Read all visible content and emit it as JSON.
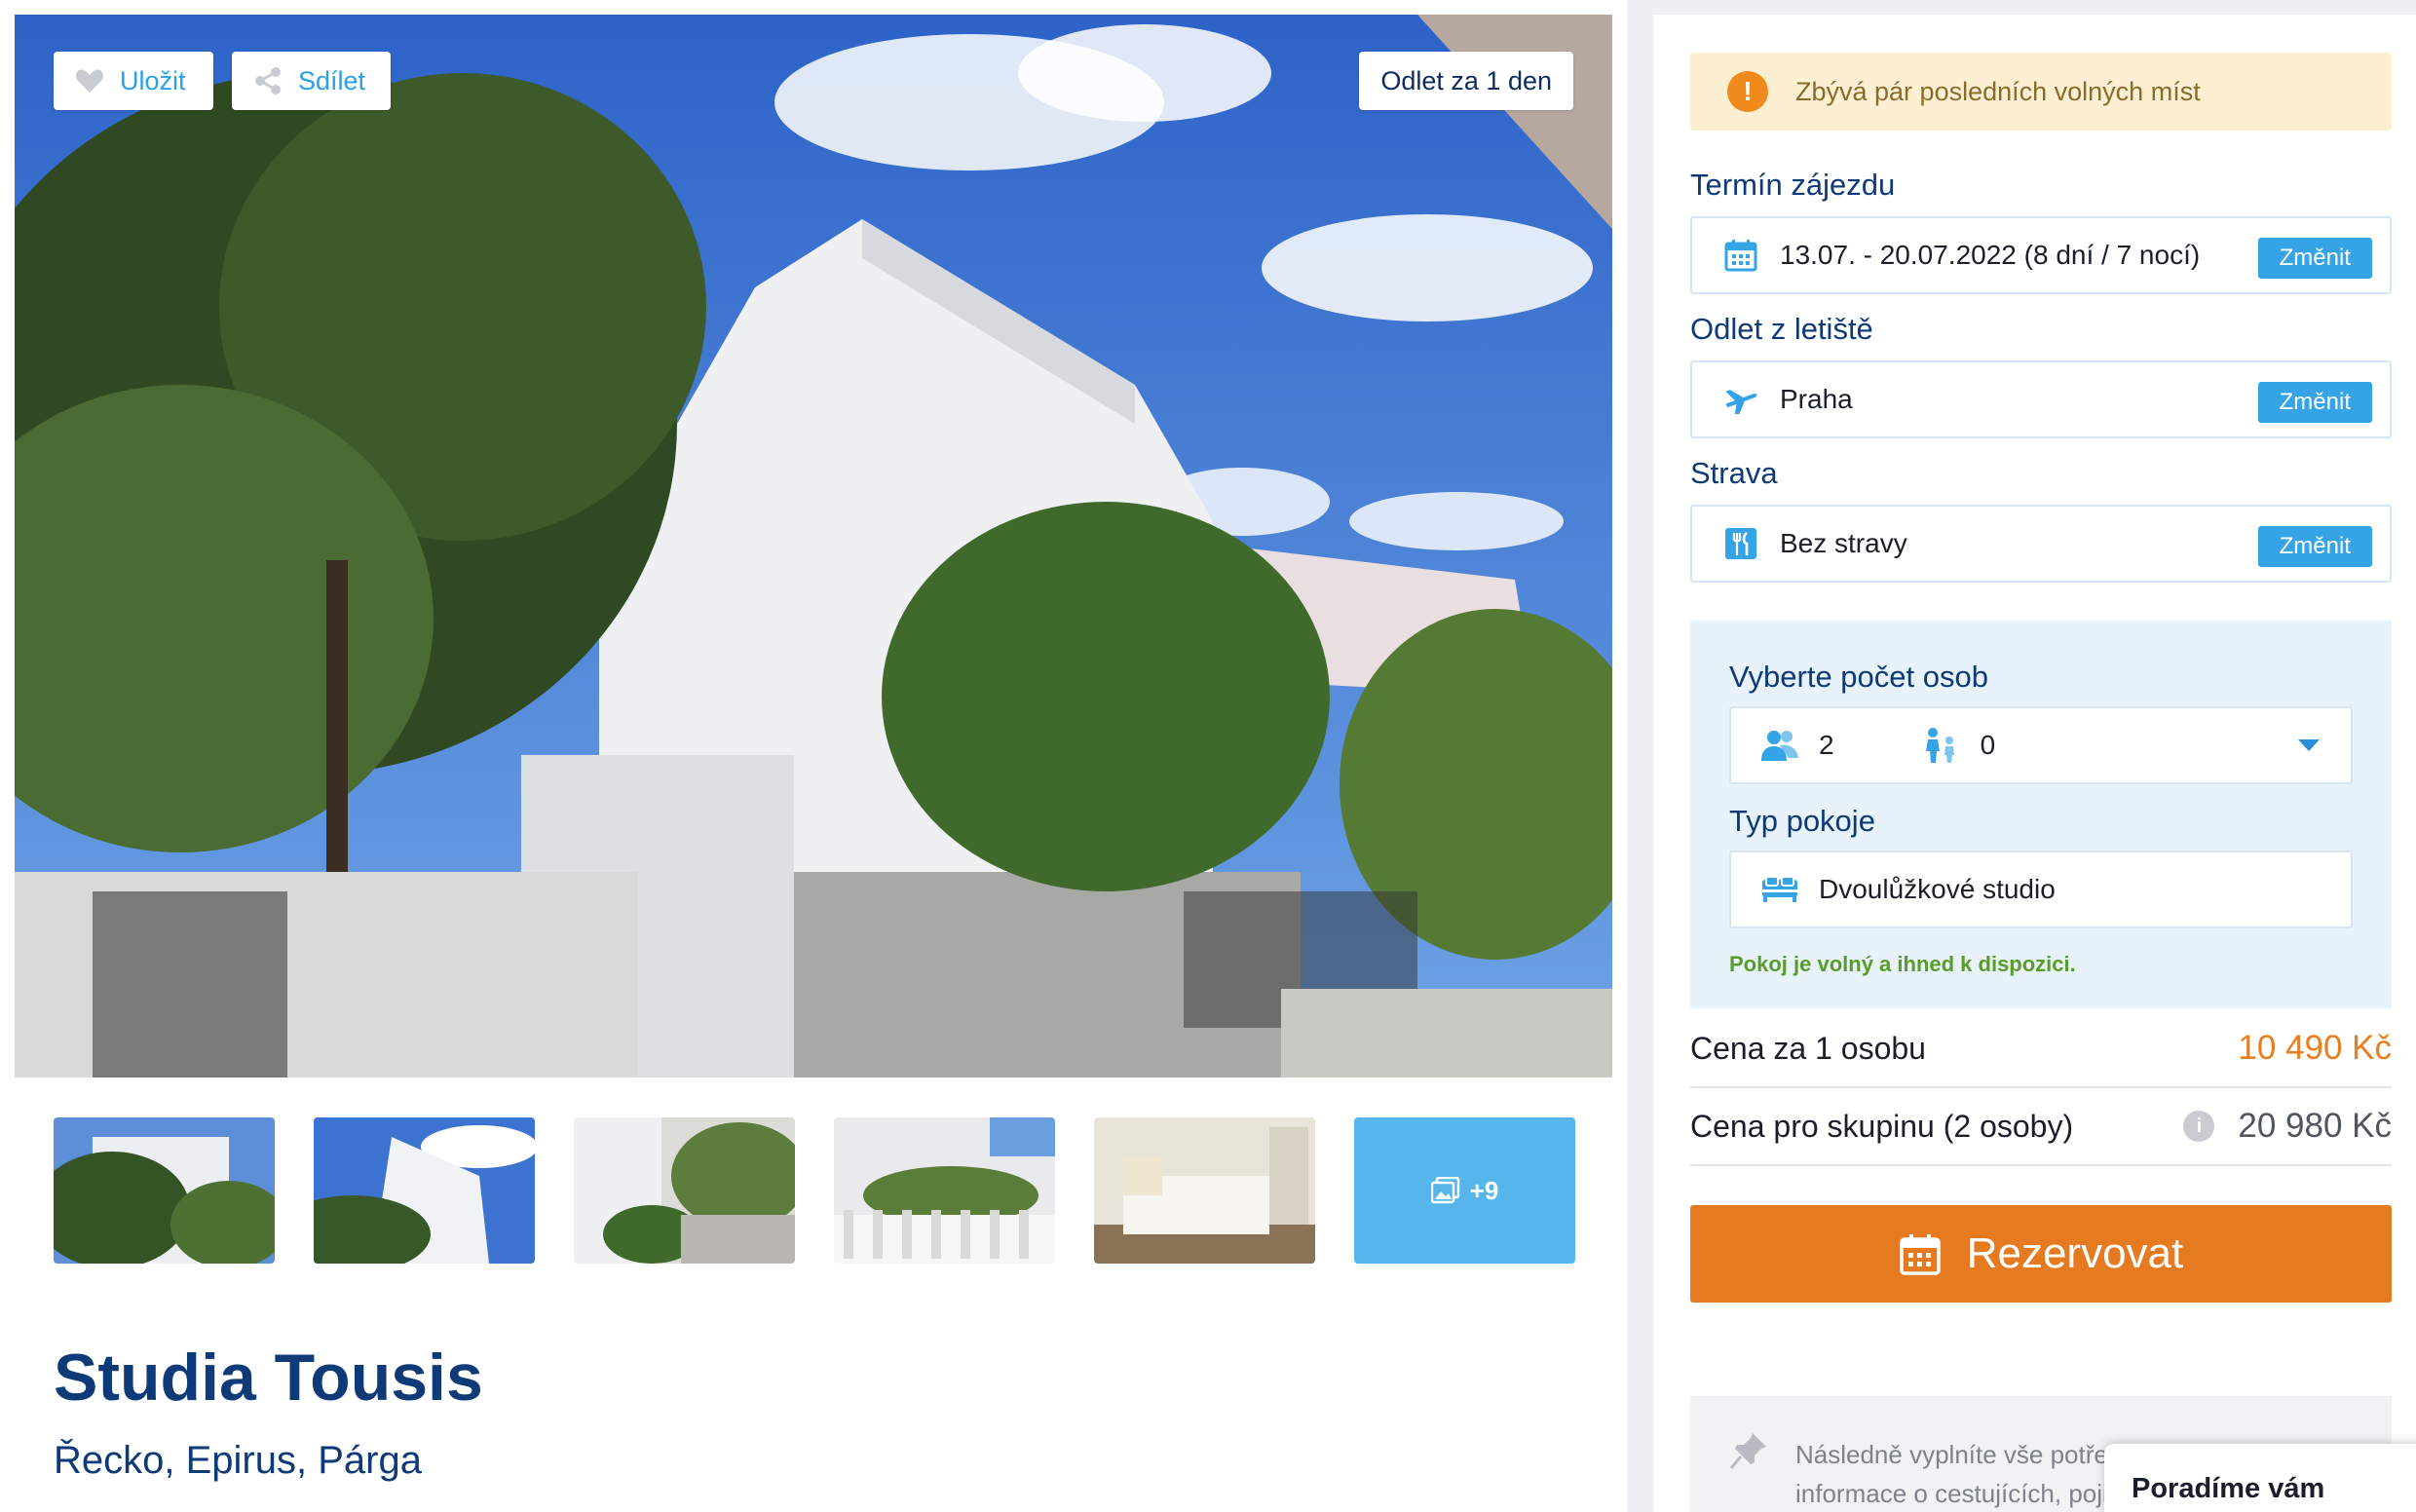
{
  "gallery": {
    "save_label": "Uložit",
    "share_label": "Sdílet",
    "departure_badge": "Odlet za 1 den",
    "more_photos": "+9"
  },
  "hotel": {
    "title": "Studia Tousis",
    "location": "Řecko, Epirus, Párga"
  },
  "booking": {
    "alert": "Zbývá pár posledních volných míst",
    "term_label": "Termín zájezdu",
    "term_value": "13.07. - 20.07.2022 (8 dní / 7 nocí)",
    "airport_label": "Odlet z letiště",
    "airport_value": "Praha",
    "board_label": "Strava",
    "board_value": "Bez stravy",
    "change_label": "Změnit",
    "persons_label": "Vyberte počet osob",
    "adults": "2",
    "children": "0",
    "room_label": "Typ pokoje",
    "room_value": "Dvoulůžkové studio",
    "room_status": "Pokoj je volný a ihned k dispozici.",
    "price_person_label": "Cena za 1 osobu",
    "price_person_value": "10 490 Kč",
    "price_group_label": "Cena pro skupinu (2 osoby)",
    "price_group_value": "20 980 Kč",
    "book_label": "Rezervovat",
    "note_text": "Následně vyplníte vše potřebné k rezervaci tedy informace o cestujících, pojištění a způsob platby"
  },
  "chat": {
    "label": "Poradíme vám"
  },
  "colors": {
    "accent_blue": "#34a4e6",
    "title_navy": "#0e3a78",
    "price_orange": "#ea7d1f",
    "book_orange": "#e57a20",
    "alert_bg": "#fcefd2",
    "available_green": "#5a9c2a"
  },
  "icons": {
    "save": "heart-icon",
    "share": "share-icon",
    "calendar": "calendar-icon",
    "plane": "plane-icon",
    "board": "cutlery-icon",
    "adults": "adults-icon",
    "children": "child-icon",
    "bed": "bed-icon",
    "info": "info-icon",
    "pin": "pin-icon",
    "gallery": "images-icon",
    "warning": "exclamation-icon"
  }
}
